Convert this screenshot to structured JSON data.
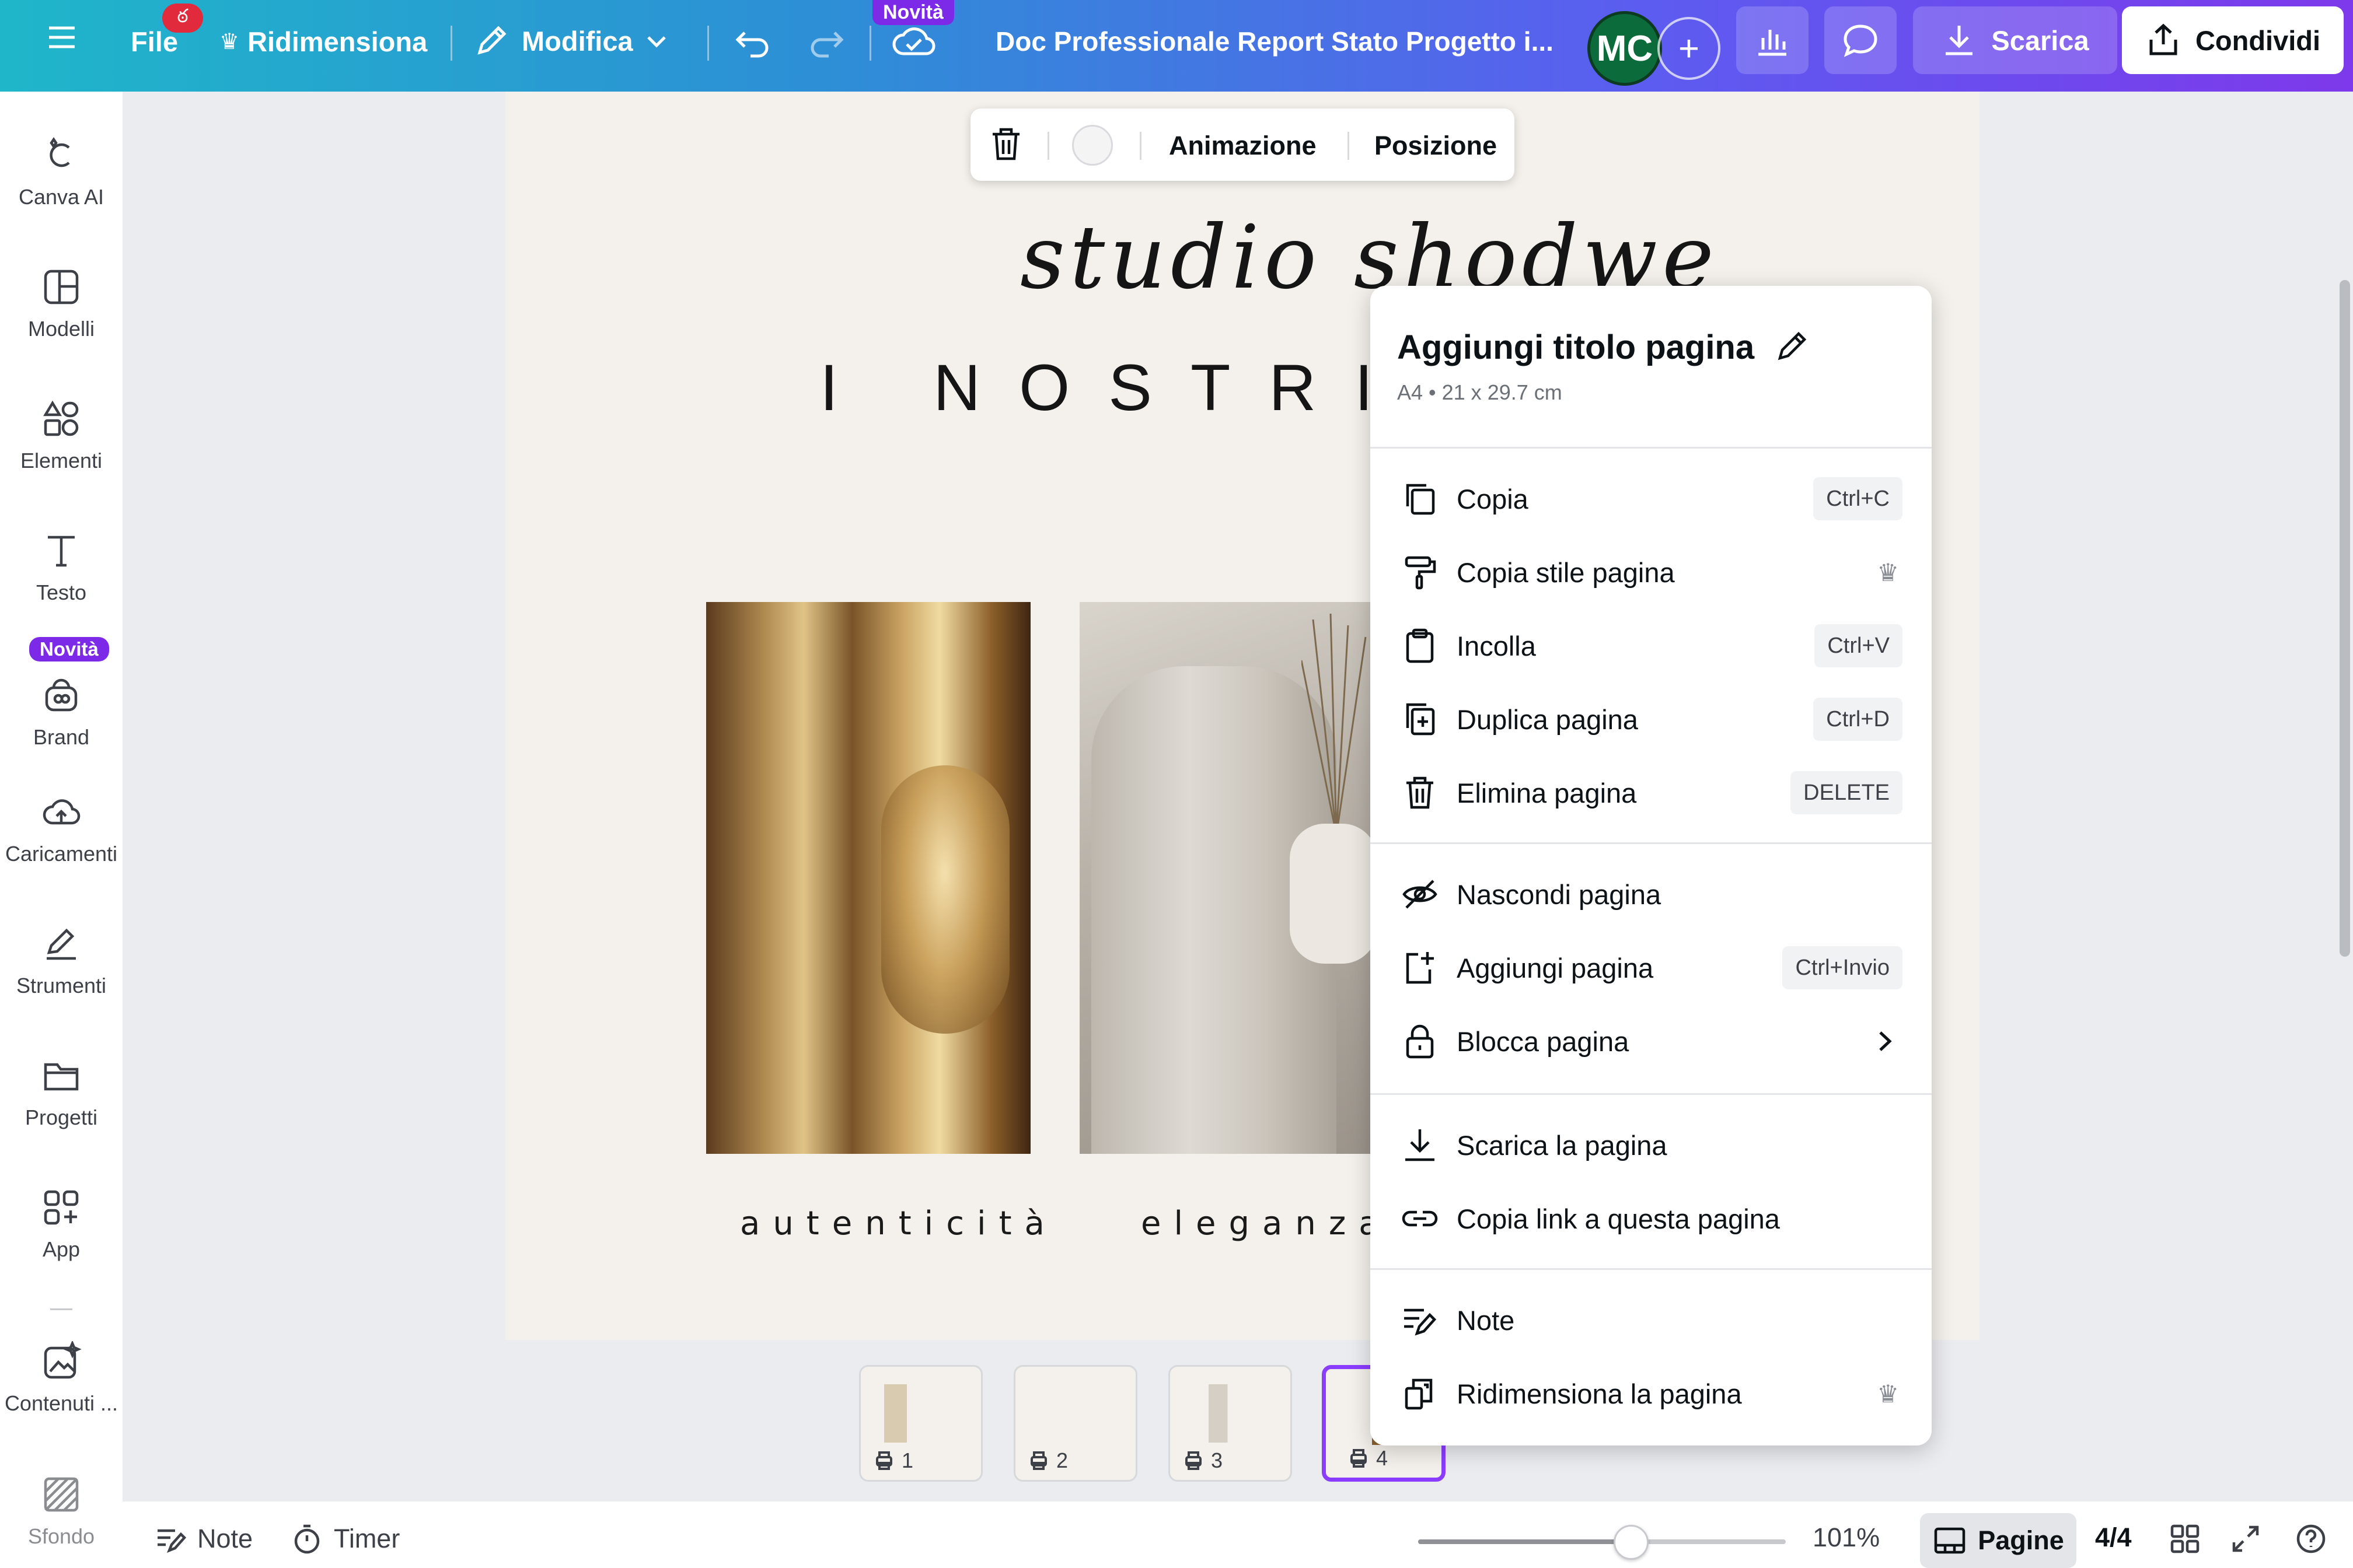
{
  "topbar": {
    "menu_icon": "hamburger-icon",
    "file_label": "File",
    "file_badge": "ఠ",
    "resize_label": "Ridimensiona",
    "edit_label": "Modifica",
    "novita_badge": "Novità",
    "doc_title": "Doc Professionale Report Stato Progetto i...",
    "avatar_initials": "MC",
    "download_label": "Scarica",
    "share_label": "Condividi"
  },
  "sidebar": {
    "novita_badge": "Novità",
    "items": [
      {
        "label": "Canva AI",
        "icon": "canva-ai-icon"
      },
      {
        "label": "Modelli",
        "icon": "templates-icon"
      },
      {
        "label": "Elementi",
        "icon": "elements-icon"
      },
      {
        "label": "Testo",
        "icon": "text-icon"
      },
      {
        "label": "Brand",
        "icon": "brand-icon"
      },
      {
        "label": "Caricamenti",
        "icon": "upload-cloud-icon"
      },
      {
        "label": "Strumenti",
        "icon": "tools-icon"
      },
      {
        "label": "Progetti",
        "icon": "folder-icon"
      },
      {
        "label": "App",
        "icon": "apps-icon"
      },
      {
        "label": "Contenuti ...",
        "icon": "magic-media-icon"
      },
      {
        "label": "Sfondo",
        "icon": "background-icon"
      }
    ]
  },
  "element_toolbar": {
    "animation_label": "Animazione",
    "position_label": "Posizione"
  },
  "design": {
    "signature": "studio shodwe",
    "headline": "I NOSTRI V",
    "caption_1": "autenticità",
    "caption_2": "eleganza"
  },
  "context_menu": {
    "title": "Aggiungi titolo pagina",
    "subtitle": "A4 • 21 x 29.7 cm",
    "items": [
      {
        "label": "Copia",
        "shortcut": "Ctrl+C",
        "icon": "copy-icon"
      },
      {
        "label": "Copia stile pagina",
        "shortcut": "",
        "icon": "paint-roller-icon",
        "crown": "♛"
      },
      {
        "label": "Incolla",
        "shortcut": "Ctrl+V",
        "icon": "clipboard-icon"
      },
      {
        "label": "Duplica pagina",
        "shortcut": "Ctrl+D",
        "icon": "duplicate-page-icon"
      },
      {
        "label": "Elimina pagina",
        "shortcut": "DELETE",
        "icon": "trash-icon"
      },
      {
        "label": "Nascondi pagina",
        "shortcut": "",
        "icon": "eye-off-icon"
      },
      {
        "label": "Aggiungi pagina",
        "shortcut": "Ctrl+Invio",
        "icon": "add-page-icon"
      },
      {
        "label": "Blocca pagina",
        "shortcut": "",
        "icon": "lock-icon"
      },
      {
        "label": "Scarica la pagina",
        "shortcut": "",
        "icon": "download-icon"
      },
      {
        "label": "Copia link a questa pagina",
        "shortcut": "",
        "icon": "link-icon"
      },
      {
        "label": "Note",
        "shortcut": "",
        "icon": "notes-icon"
      },
      {
        "label": "Ridimensiona la pagina",
        "shortcut": "",
        "icon": "resize-page-icon",
        "crown": "♛"
      }
    ]
  },
  "pages": {
    "thumbs": [
      "1",
      "2",
      "3",
      "4"
    ],
    "active": "4"
  },
  "statusbar": {
    "notes_label": "Note",
    "timer_label": "Timer",
    "zoom": "101%",
    "zoom_fraction": 0.58,
    "pages_label": "Pagine",
    "page_counter": "4/4"
  },
  "colors": {
    "accent_purple": "#8b3dff",
    "gradient_start": "#1fb6c9",
    "gradient_end": "#7d39eb",
    "badge_red": "#e12a3b"
  }
}
